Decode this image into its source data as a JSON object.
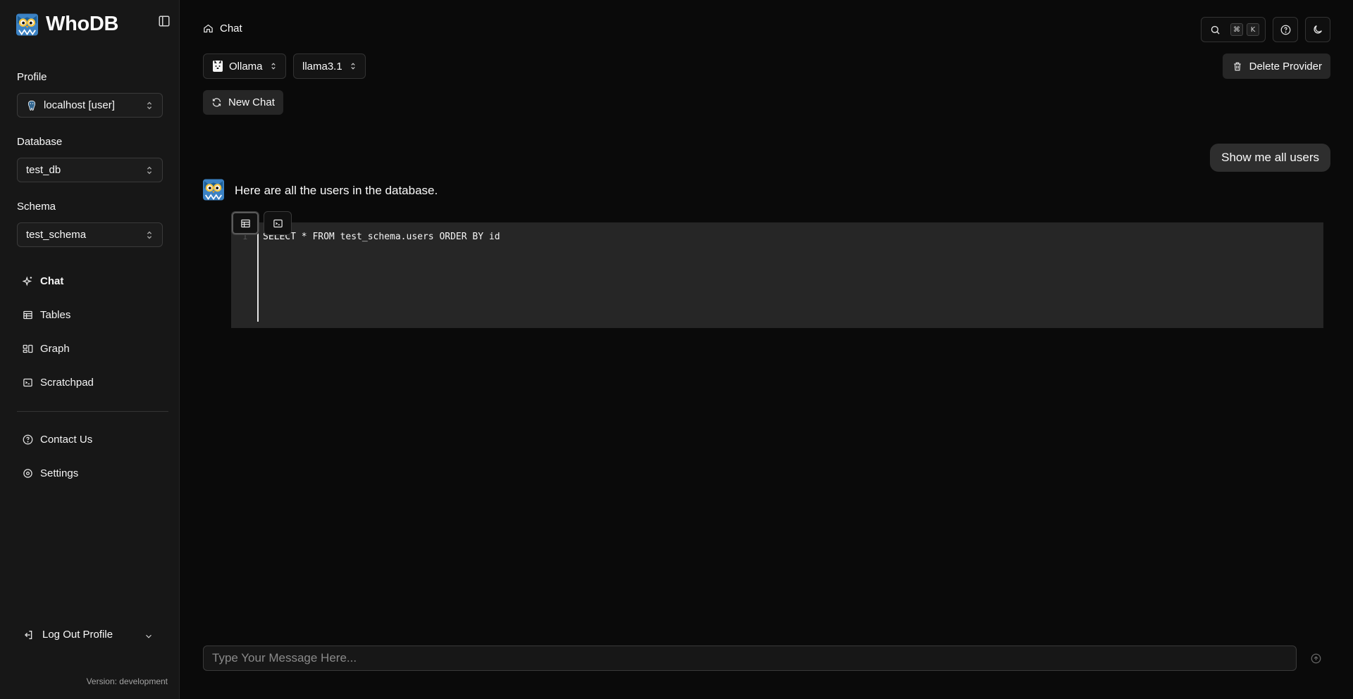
{
  "app": {
    "title": "WhoDB",
    "version": "Version: development"
  },
  "sidebar": {
    "profile_label": "Profile",
    "profile_value": "localhost [user]",
    "database_label": "Database",
    "database_value": "test_db",
    "schema_label": "Schema",
    "schema_value": "test_schema",
    "nav": [
      {
        "label": "Chat",
        "icon": "sparkles-icon",
        "active": true
      },
      {
        "label": "Tables",
        "icon": "table-icon"
      },
      {
        "label": "Graph",
        "icon": "graph-icon"
      },
      {
        "label": "Scratchpad",
        "icon": "terminal-icon"
      }
    ],
    "secondary": [
      {
        "label": "Contact Us",
        "icon": "help-circle-icon"
      },
      {
        "label": "Settings",
        "icon": "gear-icon"
      }
    ],
    "logout_label": "Log Out Profile"
  },
  "header": {
    "breadcrumb": "Chat",
    "kbd_cmd": "⌘",
    "kbd_k": "K"
  },
  "toolbar": {
    "provider": "Ollama",
    "model": "llama3.1",
    "delete_provider": "Delete Provider",
    "new_chat": "New Chat"
  },
  "chat": {
    "user_message": "Show me all users",
    "bot_message": "Here are all the users in the database.",
    "code_line_number": "1",
    "code": "SELECT * FROM test_schema.users ORDER BY id"
  },
  "composer": {
    "placeholder": "Type Your Message Here..."
  },
  "colors": {
    "background": "#0a0a0a",
    "sidebar": "#171717",
    "accent": "#262626"
  }
}
